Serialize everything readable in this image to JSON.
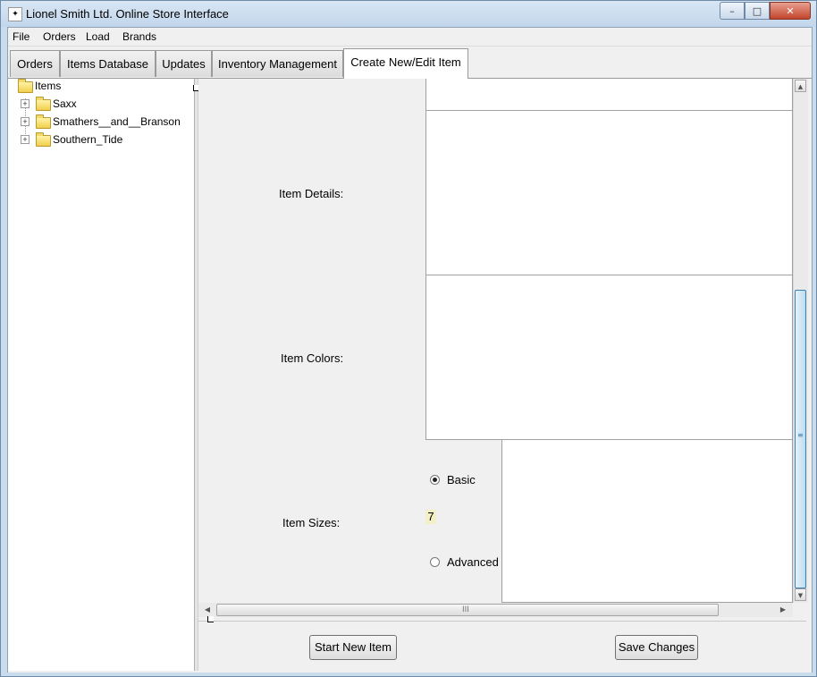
{
  "window": {
    "title": "Lionel Smith Ltd. Online Store Interface",
    "title_ghost": "...",
    "controls": {
      "minimize": "–",
      "maximize": "□",
      "close": "✕"
    }
  },
  "menu": {
    "items": [
      "File",
      "Orders",
      "Load",
      "Brands"
    ]
  },
  "tabs": [
    {
      "label": "Orders",
      "active": false
    },
    {
      "label": "Items Database",
      "active": false
    },
    {
      "label": "Updates",
      "active": false
    },
    {
      "label": "Inventory Management",
      "active": false
    },
    {
      "label": "Create New/Edit Item",
      "active": true
    }
  ],
  "tree": {
    "root": "Items",
    "children": [
      "Saxx",
      "Smathers__and__Branson",
      "Southern_Tide"
    ],
    "expander_glyph": "+"
  },
  "form": {
    "item_details_label": "Item Details:",
    "item_colors_label": "Item Colors:",
    "item_sizes_label": "Item Sizes:",
    "size_mode": {
      "basic_label": "Basic",
      "advanced_label": "Advanced",
      "selected": "Basic",
      "size_count": "7"
    }
  },
  "scrollbars": {
    "up_arrow": "▲",
    "down_arrow": "▼",
    "left_arrow": "◀",
    "right_arrow": "▶",
    "grip_h": "III",
    "grip_v": "≡"
  },
  "buttons": {
    "start_new_item": "Start New Item",
    "save_changes": "Save Changes"
  }
}
